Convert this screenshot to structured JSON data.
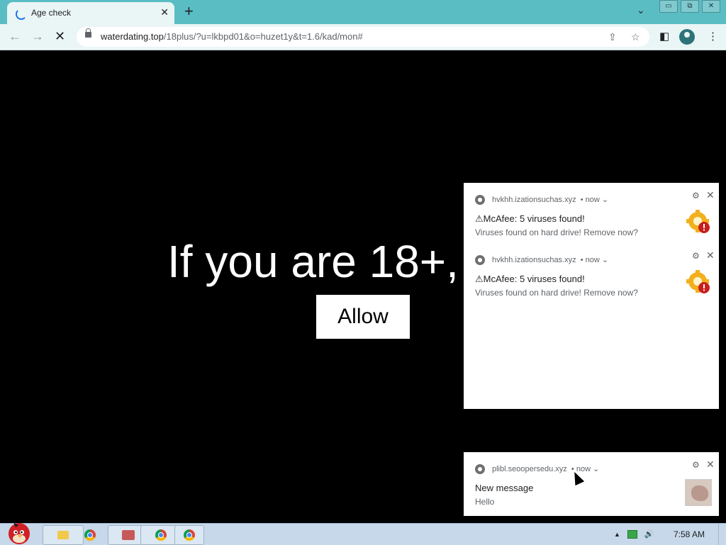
{
  "browser": {
    "tab_title": "Age check",
    "tab_close": "✕",
    "new_tab": "+",
    "tab_search": "⌄",
    "window_controls": [
      "▭",
      "⧉",
      "✕"
    ],
    "nav": {
      "back": "←",
      "forward": "→",
      "reload": "✕"
    },
    "url_host": "waterdating.top",
    "url_path": "/18plus/?u=lkbpd01&o=huzet1y&t=1.6/kad/mon#",
    "share_icon": "⇪",
    "bookmark_icon": "☆",
    "side_panel_icon": "◧",
    "menu_icon": "⋮"
  },
  "page": {
    "headline": "If you are 18+,",
    "allow_label": "Allow"
  },
  "notifications": [
    {
      "origin": "hvkhh.izationsuchas.xyz",
      "time": "• now ⌄",
      "title": "⚠McAfee: 5 viruses found!",
      "body": "Viruses found on hard drive! Remove now?",
      "icon": "gear-warning-icon"
    },
    {
      "origin": "hvkhh.izationsuchas.xyz",
      "time": "• now ⌄",
      "title": "⚠McAfee: 5 viruses found!",
      "body": "Viruses found on hard drive! Remove now?",
      "icon": "gear-warning-icon"
    },
    {
      "origin": "plibl.seoopersedu.xyz",
      "time": "• now ⌄",
      "title": "New message",
      "body": "Hello",
      "icon": "photo-thumbnail"
    }
  ],
  "notification_controls": {
    "settings": "⚙",
    "close": "✕"
  },
  "taskbar": {
    "clock": "7:58 AM",
    "tray_arrow": "▲",
    "volume_icon": "🔊"
  },
  "colors": {
    "tabbar": "#5bbdc4",
    "toolbar": "#eaf5f6",
    "page_bg": "#000000",
    "taskbar": "#c6d8e9"
  }
}
